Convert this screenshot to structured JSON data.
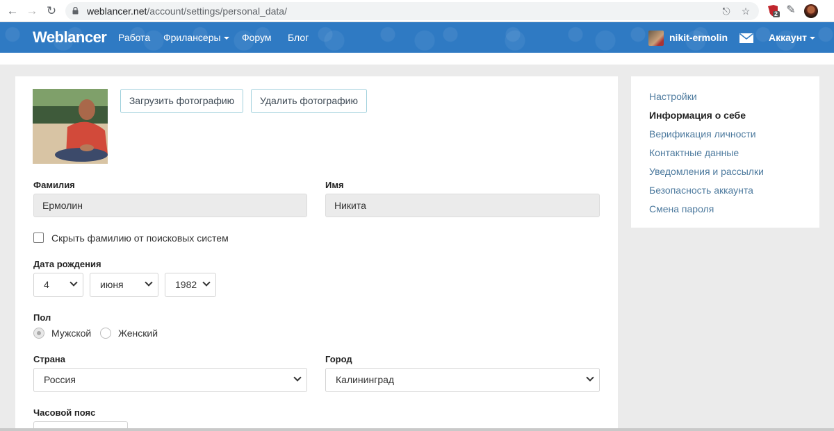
{
  "browser": {
    "url_host": "weblancer.net",
    "url_path": "/account/settings/personal_data/",
    "extension_badge": "2"
  },
  "header": {
    "logo": "Weblancer",
    "nav": [
      "Работа",
      "Фрилансеры",
      "Форум",
      "Блог"
    ],
    "username": "nikit-ermolin",
    "account_label": "Аккаунт"
  },
  "photo": {
    "upload_label": "Загрузить фотографию",
    "delete_label": "Удалить фотографию"
  },
  "form": {
    "lastname_label": "Фамилия",
    "lastname_value": "Ермолин",
    "firstname_label": "Имя",
    "firstname_value": "Никита",
    "hide_lastname_label": "Скрыть фамилию от поисковых систем",
    "hide_lastname_checked": false,
    "birthdate_label": "Дата рождения",
    "birth_day": "4",
    "birth_month": "июня",
    "birth_year": "1982",
    "gender_label": "Пол",
    "gender_male": "Мужской",
    "gender_female": "Женский",
    "gender_selected": "male",
    "country_label": "Страна",
    "country_value": "Россия",
    "city_label": "Город",
    "city_value": "Калининград",
    "timezone_label": "Часовой пояс"
  },
  "sidebar": {
    "items": [
      {
        "label": "Настройки",
        "active": false
      },
      {
        "label": "Информация о себе",
        "active": true
      },
      {
        "label": "Верификация личности",
        "active": false
      },
      {
        "label": "Контактные данные",
        "active": false
      },
      {
        "label": "Уведомления и рассылки",
        "active": false
      },
      {
        "label": "Безопасность аккаунта",
        "active": false
      },
      {
        "label": "Смена пароля",
        "active": false
      }
    ]
  },
  "icons": [
    "back-arrow-icon",
    "forward-arrow-icon",
    "reload-icon",
    "lock-icon",
    "share-icon",
    "star-icon",
    "puzzle-icon",
    "mail-icon",
    "chevron-down-icon"
  ],
  "colors": {
    "header_blue": "#2f7ac3",
    "link_blue": "#4d7a9e",
    "button_border": "#9fd0dc"
  }
}
